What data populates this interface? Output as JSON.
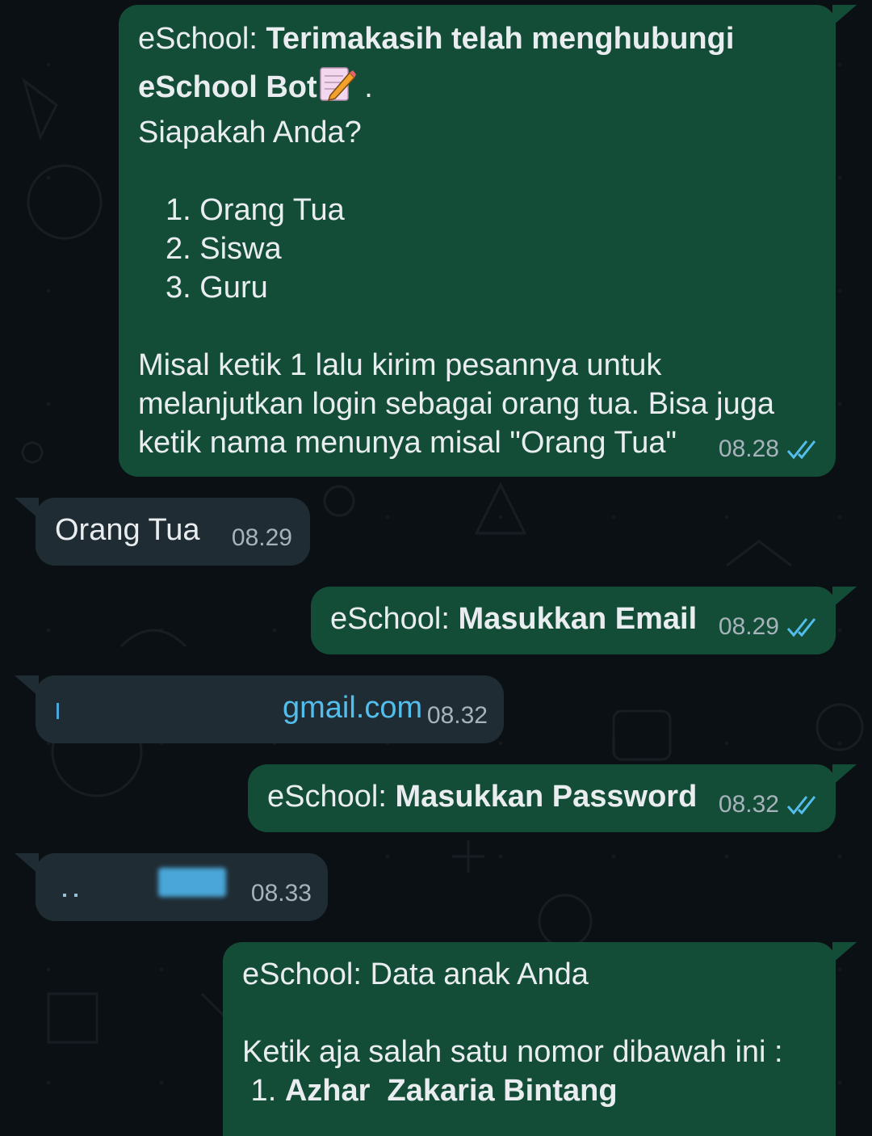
{
  "messages": [
    {
      "id": "m1",
      "direction": "outgoing",
      "prefix": "eSchool: ",
      "bold_line1": "Terimakasih telah menghubungi",
      "bold_line2": "eSchool Bot",
      "after_emoji": " .",
      "line3": "Siapakah Anda?",
      "options": [
        "1. Orang Tua",
        "2. Siswa",
        "3. Guru"
      ],
      "body": [
        "Misal ketik 1 lalu kirim pesannya untuk",
        "melanjutkan login sebagai orang tua. Bisa juga",
        "ketik nama menunya misal \"Orang Tua\""
      ],
      "time": "08.28",
      "status": "read"
    },
    {
      "id": "m2",
      "direction": "incoming",
      "text": "Orang Tua",
      "time": "08.29"
    },
    {
      "id": "m3",
      "direction": "outgoing",
      "prefix": "eSchool: ",
      "bold": "Masukkan Email",
      "time": "08.29",
      "status": "read"
    },
    {
      "id": "m4",
      "direction": "incoming",
      "text": "gmail.com",
      "time": "08.32",
      "redacted": true
    },
    {
      "id": "m5",
      "direction": "outgoing",
      "prefix": "eSchool: ",
      "bold": "Masukkan Password",
      "time": "08.32",
      "status": "read"
    },
    {
      "id": "m6",
      "direction": "incoming",
      "time": "08.33",
      "redacted": true
    },
    {
      "id": "m7",
      "direction": "outgoing",
      "line1": "eSchool: Data anak Anda",
      "line2": "Ketik aja salah satu nomor dibawah ini :",
      "item_num": " 1. ",
      "item_name": "Azhar  Zakaria Bintang"
    }
  ],
  "icons": {
    "read_receipt": "double-check-icon",
    "emoji": "memo-icon"
  },
  "colors": {
    "outgoing_bubble": "#144d37",
    "incoming_bubble": "#1f2c34",
    "read_tick": "#53bdeb",
    "background": "#0b1014"
  }
}
